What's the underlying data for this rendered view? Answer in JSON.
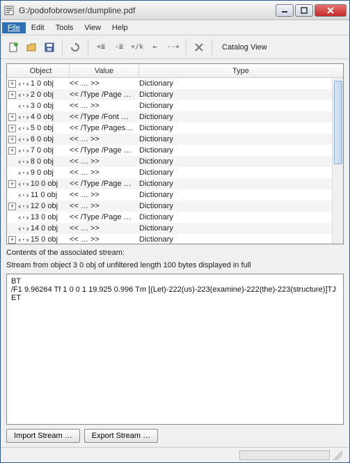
{
  "window": {
    "title": "G:/podofobrowser/dumpline.pdf"
  },
  "menubar": {
    "file": "File",
    "edit": "Edit",
    "tools": "Tools",
    "view": "View",
    "help": "Help"
  },
  "toolbar": {
    "catalog_label": "Catalog View"
  },
  "table": {
    "headers": {
      "object": "Object",
      "value": "Value",
      "type": "Type"
    },
    "rows": [
      {
        "expandable": true,
        "object": "1 0 obj",
        "value": "<< … >>",
        "type": "Dictionary"
      },
      {
        "expandable": true,
        "object": "2 0 obj",
        "value": "<< /Type /Page …",
        "type": "Dictionary"
      },
      {
        "expandable": false,
        "object": "3 0 obj",
        "value": "<< … >>",
        "type": "Dictionary"
      },
      {
        "expandable": true,
        "object": "4 0 obj",
        "value": "<< /Type /Font …",
        "type": "Dictionary"
      },
      {
        "expandable": true,
        "object": "5 0 obj",
        "value": "<< /Type /Pages…",
        "type": "Dictionary"
      },
      {
        "expandable": true,
        "object": "6 0 obj",
        "value": "<< … >>",
        "type": "Dictionary"
      },
      {
        "expandable": true,
        "object": "7 0 obj",
        "value": "<< /Type /Page …",
        "type": "Dictionary"
      },
      {
        "expandable": false,
        "object": "8 0 obj",
        "value": "<< … >>",
        "type": "Dictionary"
      },
      {
        "expandable": false,
        "object": "9 0 obj",
        "value": "<< … >>",
        "type": "Dictionary"
      },
      {
        "expandable": true,
        "object": "10 0 obj",
        "value": "<< /Type /Page …",
        "type": "Dictionary"
      },
      {
        "expandable": false,
        "object": "11 0 obj",
        "value": "<< … >>",
        "type": "Dictionary"
      },
      {
        "expandable": true,
        "object": "12 0 obj",
        "value": "<< … >>",
        "type": "Dictionary"
      },
      {
        "expandable": false,
        "object": "13 0 obj",
        "value": "<< /Type /Page …",
        "type": "Dictionary"
      },
      {
        "expandable": false,
        "object": "14 0 obj",
        "value": "<< … >>",
        "type": "Dictionary"
      },
      {
        "expandable": true,
        "object": "15 0 obj",
        "value": "<< … >>",
        "type": "Dictionary"
      }
    ]
  },
  "stream": {
    "title": "Contents of the associated stream:",
    "info": "Stream from object 3 0 obj of unfiltered length 100 bytes displayed in full",
    "content": "BT\n/F1 9.96264 Tf 1 0 0 1 19.925 0.996 Tm [(Let)-222(us)-223(examine)-222(the)-223(structure)]TJ\nET"
  },
  "buttons": {
    "import": "Import Stream …",
    "export": "Export Stream …"
  }
}
